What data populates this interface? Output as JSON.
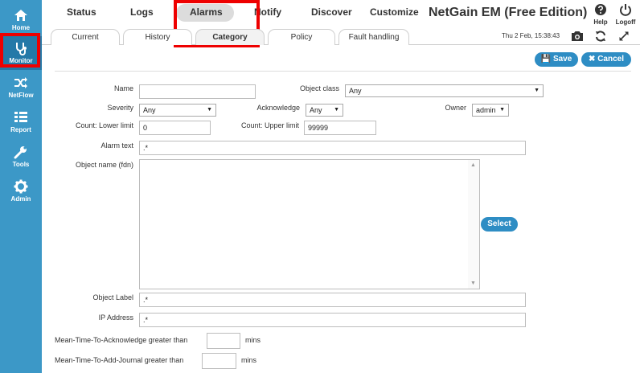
{
  "sidebar": {
    "items": [
      {
        "label": "Home",
        "icon": "home-icon"
      },
      {
        "label": "Monitor",
        "icon": "stethoscope-icon",
        "active": true
      },
      {
        "label": "NetFlow",
        "icon": "shuffle-icon"
      },
      {
        "label": "Report",
        "icon": "list-icon"
      },
      {
        "label": "Tools",
        "icon": "wrench-icon"
      },
      {
        "label": "Admin",
        "icon": "gear-icon"
      }
    ]
  },
  "topnav": {
    "items": [
      "Status",
      "Logs",
      "Alarms",
      "Notify",
      "Discover",
      "Customize"
    ],
    "active": "Alarms"
  },
  "app_title": "NetGain EM (Free Edition)",
  "top_right": {
    "help_label": "Help",
    "logoff_label": "Logoff"
  },
  "subtabs": {
    "items": [
      "Current",
      "History",
      "Category",
      "Policy",
      "Fault handling"
    ],
    "active": "Category"
  },
  "timestamp": "Thu 2 Feb, 15:38:43",
  "actions": {
    "save_label": "Save",
    "cancel_label": "Cancel"
  },
  "form": {
    "name": {
      "label": "Name",
      "value": ""
    },
    "object_class": {
      "label": "Object class",
      "value": "Any"
    },
    "severity": {
      "label": "Severity",
      "value": "Any"
    },
    "acknowledge": {
      "label": "Acknowledge",
      "value": "Any"
    },
    "owner": {
      "label": "Owner",
      "value": "admin"
    },
    "count_lower": {
      "label": "Count: Lower limit",
      "value": "0"
    },
    "count_upper": {
      "label": "Count: Upper limit",
      "value": "99999"
    },
    "alarm_text": {
      "label": "Alarm text",
      "value": ".*"
    },
    "object_name": {
      "label": "Object name (fdn)",
      "value": ""
    },
    "select_label": "Select",
    "object_label": {
      "label": "Object Label",
      "value": ".*"
    },
    "ip_address": {
      "label": "IP Address",
      "value": ".*"
    },
    "mtta": {
      "label": "Mean-Time-To-Acknowledge greater than",
      "value": "",
      "unit": "mins"
    },
    "mttaj": {
      "label": "Mean-Time-To-Add-Journal greater than",
      "value": "",
      "unit": "mins"
    }
  },
  "colors": {
    "sidebar": "#3c98c7",
    "accent": "#2e8dc4",
    "highlight": "#ee0000"
  }
}
